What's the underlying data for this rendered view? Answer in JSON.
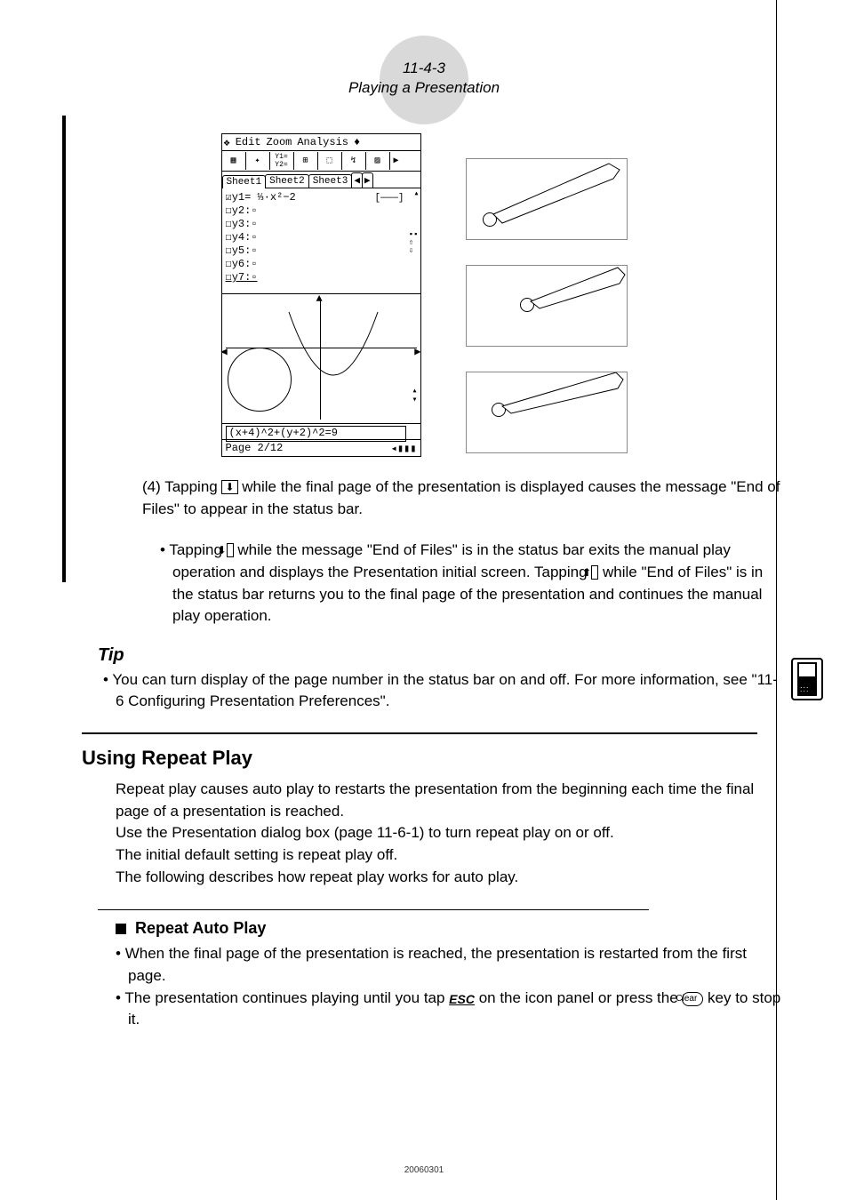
{
  "header": {
    "page_ref": "11-4-3",
    "title": "Playing a Presentation"
  },
  "screenshot": {
    "menu": {
      "clover": "❖",
      "edit": "Edit",
      "zoom": "Zoom",
      "analysis": "Analysis",
      "arrows": "♦"
    },
    "toolbar_arrow": "▶",
    "tabs": {
      "t1": "Sheet1",
      "t2": "Sheet2",
      "t3": "Sheet3",
      "nav_l": "◀",
      "nav_r": "▶"
    },
    "eq": {
      "y1": "☑y1= ⅓·x²−2",
      "bracket": "[———]",
      "y2": "☐y2:▫",
      "y3": "☐y3:▫",
      "y4": "☐y4:▫",
      "y5": "☐y5:▫",
      "y6": "☐y6:▫",
      "y7": "☐y7:▫"
    },
    "circle_eq": "(x+4)^2+(y+2)^2=9",
    "status": {
      "page": "Page 2/12",
      "batt": "◂▮▮▮"
    }
  },
  "para4": {
    "lead": "(4) Tapping ",
    "after_icon": " while the final page of the presentation is displayed causes the message \"End of Files\" to appear in the status bar."
  },
  "para4_bullet": {
    "p1": "Tapping ",
    "p2": " while the message \"End of Files\" is in the status bar exits the manual play operation and displays the Presentation initial screen. Tapping ",
    "p3": " while \"End of Files\" is in the status bar returns you to the final page of the presentation and continues the manual play operation."
  },
  "tip": {
    "heading": "Tip",
    "text": "You can turn display of the page number in the status bar on and off. For more information, see \"11-6 Configuring Presentation Preferences\"."
  },
  "repeat": {
    "heading": "Using Repeat Play",
    "p1": "Repeat play causes auto play to restarts the presentation from the beginning each time the final page of a presentation is reached.",
    "p2": "Use the Presentation dialog box (page 11-6-1) to turn repeat play on or off.",
    "p3": "The initial default setting is repeat play off.",
    "p4": "The following describes how repeat play works for auto play."
  },
  "auto": {
    "heading": "Repeat Auto Play",
    "b1": "When the final page of the presentation is reached, the presentation is restarted from the first page.",
    "b2a": "The presentation continues playing until you tap ",
    "b2b": " on the icon panel or press the ",
    "b2c": " key to stop it."
  },
  "icons": {
    "down": "⬇",
    "up": "⬆",
    "esc": "ESC",
    "clear": "Clear"
  },
  "footer": "20060301"
}
